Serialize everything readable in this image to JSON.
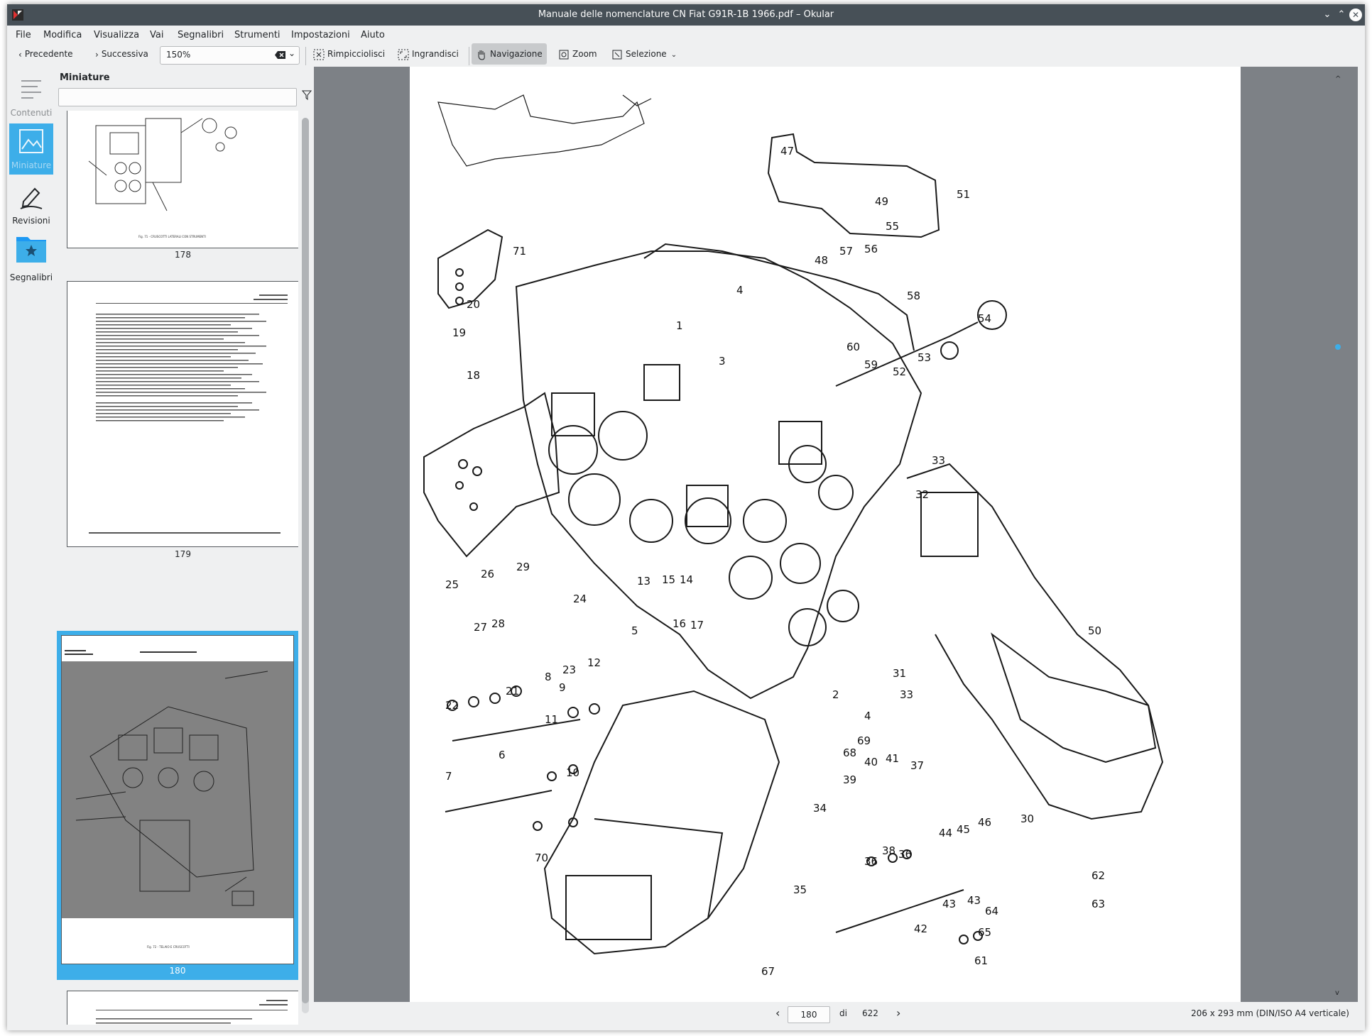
{
  "window": {
    "title": "Manuale delle nomenclature CN Fiat G91R-1B 1966.pdf – Okular"
  },
  "menu": [
    "File",
    "Modifica",
    "Visualizza",
    "Vai",
    "Segnalibri",
    "Strumenti",
    "Impostazioni",
    "Aiuto"
  ],
  "toolbar": {
    "prev_label": "Precedente",
    "next_label": "Successiva",
    "zoom_value": "150%",
    "shrink_label": "Rimpicciolisci",
    "enlarge_label": "Ingrandisci",
    "navigation_label": "Navigazione",
    "zoom_label": "Zoom",
    "selection_label": "Selezione"
  },
  "sidebar": {
    "items": [
      {
        "label": "Contenuti",
        "icon": "table-of-contents-icon",
        "state": "disabled"
      },
      {
        "label": "Miniature",
        "icon": "thumbnails-icon",
        "state": "selected"
      },
      {
        "label": "Revisioni",
        "icon": "pen-icon",
        "state": "normal"
      },
      {
        "label": "Segnalibri",
        "icon": "bookmark-folder-icon",
        "state": "normal"
      }
    ]
  },
  "thumbnails": {
    "panel_title": "Miniature",
    "filter_placeholder": "",
    "pages": [
      {
        "number": "178",
        "caption": "Fig. 71 - CRUSCOTTI LATERALI CON STRUMENTI"
      },
      {
        "number": "179",
        "caption": ""
      },
      {
        "number": "180",
        "caption": "Fig. 72 - TELAIO E CRUSCOTTI",
        "selected": true
      },
      {
        "number": "",
        "caption": ""
      }
    ]
  },
  "document": {
    "callouts": [
      "47",
      "49",
      "51",
      "55",
      "56",
      "57",
      "58",
      "71",
      "20",
      "19",
      "48",
      "54",
      "60",
      "59",
      "52",
      "53",
      "4",
      "1",
      "3",
      "18",
      "33",
      "32",
      "25",
      "26",
      "29",
      "27",
      "28",
      "24",
      "13",
      "15",
      "14",
      "16",
      "17",
      "5",
      "22",
      "21",
      "23",
      "12",
      "8",
      "9",
      "11",
      "7",
      "6",
      "10",
      "31",
      "2",
      "33",
      "4",
      "69",
      "68",
      "39",
      "40",
      "41",
      "37",
      "34",
      "38",
      "36",
      "36",
      "35",
      "44",
      "45",
      "46",
      "43",
      "43",
      "42",
      "70",
      "67",
      "50",
      "30",
      "62",
      "63",
      "64",
      "65",
      "61"
    ]
  },
  "statusbar": {
    "current_page": "180",
    "of_word": "di",
    "total_pages": "622",
    "page_size": "206 x 293 mm (DIN/ISO A4 verticale)"
  }
}
